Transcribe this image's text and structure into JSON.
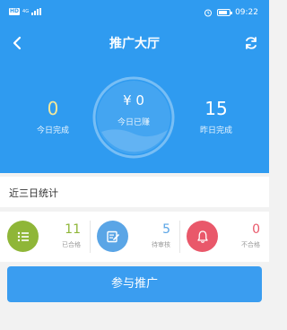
{
  "status_bar": {
    "left_badge": "HD",
    "network_label": "4G",
    "time": "09:22"
  },
  "header": {
    "title": "推广大厅",
    "back_icon": "chevron-left-icon",
    "refresh_icon": "refresh-icon"
  },
  "summary": {
    "today_completed_value": "0",
    "today_completed_label": "今日完成",
    "today_earned_value": "¥ 0",
    "today_earned_label": "今日已赚",
    "yesterday_completed_value": "15",
    "yesterday_completed_label": "昨日完成"
  },
  "recent": {
    "title": "近三日统计",
    "items": [
      {
        "value": "11",
        "label": "已合格",
        "icon": "list-icon",
        "color": "#8fb638"
      },
      {
        "value": "5",
        "label": "待审核",
        "icon": "edit-note-icon",
        "color": "#5aa5e6"
      },
      {
        "value": "0",
        "label": "不合格",
        "icon": "bell-icon",
        "color": "#e9586a"
      }
    ]
  },
  "cta": {
    "label": "参与推广"
  },
  "colors": {
    "primary": "#2f9bf0",
    "accent_yellow": "#f3e89a"
  }
}
